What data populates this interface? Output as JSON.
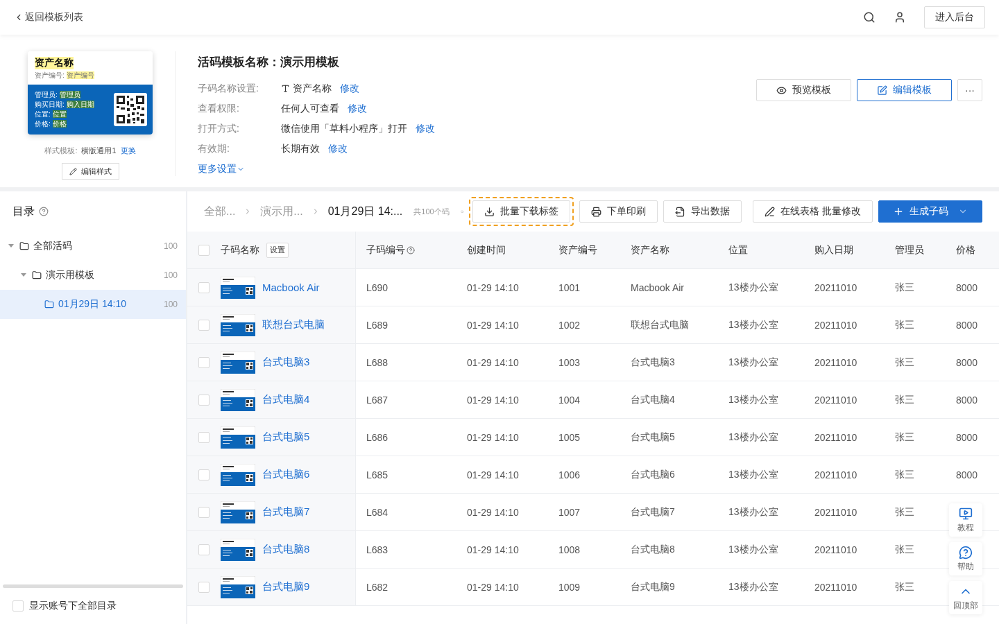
{
  "topbar": {
    "back": "返回模板列表",
    "action": "进入后台"
  },
  "template": {
    "card": {
      "title": "资产名称",
      "subtitle_label": "资产编号:",
      "subtitle_value": "资产编号",
      "fields": [
        {
          "label": "管理员:",
          "value": "管理员"
        },
        {
          "label": "购买日期:",
          "value": "购入日期"
        },
        {
          "label": "位置:",
          "value": "位置"
        },
        {
          "label": "价格:",
          "value": "价格"
        }
      ]
    },
    "style_label": "样式模板:",
    "style_value": "横版通用1",
    "style_link": "更换",
    "edit_style": "编辑样式",
    "title": "活码模板名称：演示用模板",
    "settings": [
      {
        "kind": "field",
        "label": "子码名称设置:",
        "value": "资产名称",
        "link": "修改"
      },
      {
        "kind": "text",
        "label": "查看权限:",
        "value": "任何人可查看",
        "link": "修改"
      },
      {
        "kind": "text",
        "label": "打开方式:",
        "value": "微信使用「草料小程序」打开",
        "link": "修改"
      },
      {
        "kind": "text",
        "label": "有效期:",
        "value": "长期有效",
        "link": "修改"
      }
    ],
    "more": "更多设置",
    "buttons": [
      {
        "kind": "preview",
        "label": "预览模板"
      },
      {
        "kind": "edit",
        "label": "编辑模板"
      },
      {
        "kind": "more",
        "label": "···"
      }
    ]
  },
  "sidebar": {
    "title": "目录",
    "tree": [
      {
        "label": "全部活码",
        "count": "100",
        "expanded": true,
        "selected": false,
        "children": [
          {
            "label": "演示用模板",
            "count": "100",
            "expanded": true,
            "selected": false,
            "children": [
              {
                "label": "01月29日 14:10",
                "count": "100",
                "selected": true
              }
            ]
          }
        ]
      }
    ],
    "show_all": {
      "label": "显示账号下全部目录",
      "checked": false
    }
  },
  "toolbar": {
    "breadcrumb": [
      "全部...",
      "演示用...",
      "01月29日 14:..."
    ],
    "total": "共100个码",
    "buttons": [
      {
        "kind": "download",
        "label": "批量下载标签",
        "highlighted": true
      },
      {
        "kind": "print",
        "label": "下单印刷",
        "highlighted": false
      },
      {
        "kind": "export",
        "label": "导出数据",
        "highlighted": false
      },
      {
        "kind": "edit",
        "label": "在线表格 批量修改",
        "highlighted": false
      },
      {
        "kind": "primary",
        "label": "生成子码",
        "highlighted": false
      }
    ]
  },
  "table": {
    "all_checked": false,
    "setting": "设置",
    "columns": [
      "子码名称",
      "子码编号",
      "创建时间",
      "资产编号",
      "资产名称",
      "位置",
      "购入日期",
      "管理员",
      "价格"
    ],
    "rows": [
      {
        "checked": false,
        "cells": [
          "Macbook Air",
          "L690",
          "01-29 14:10",
          "1001",
          "Macbook Air",
          "13楼办公室",
          "20211010",
          "张三",
          "8000"
        ]
      },
      {
        "checked": false,
        "cells": [
          "联想台式电脑",
          "L689",
          "01-29 14:10",
          "1002",
          "联想台式电脑",
          "13楼办公室",
          "20211010",
          "张三",
          "8000"
        ]
      },
      {
        "checked": false,
        "cells": [
          "台式电脑3",
          "L688",
          "01-29 14:10",
          "1003",
          "台式电脑3",
          "13楼办公室",
          "20211010",
          "张三",
          "8000"
        ]
      },
      {
        "checked": false,
        "cells": [
          "台式电脑4",
          "L687",
          "01-29 14:10",
          "1004",
          "台式电脑4",
          "13楼办公室",
          "20211010",
          "张三",
          "8000"
        ]
      },
      {
        "checked": false,
        "cells": [
          "台式电脑5",
          "L686",
          "01-29 14:10",
          "1005",
          "台式电脑5",
          "13楼办公室",
          "20211010",
          "张三",
          "8000"
        ]
      },
      {
        "checked": false,
        "cells": [
          "台式电脑6",
          "L685",
          "01-29 14:10",
          "1006",
          "台式电脑6",
          "13楼办公室",
          "20211010",
          "张三",
          "8000"
        ]
      },
      {
        "checked": false,
        "cells": [
          "台式电脑7",
          "L684",
          "01-29 14:10",
          "1007",
          "台式电脑7",
          "13楼办公室",
          "20211010",
          "张三"
        ]
      },
      {
        "checked": false,
        "cells": [
          "台式电脑8",
          "L683",
          "01-29 14:10",
          "1008",
          "台式电脑8",
          "13楼办公室",
          "20211010",
          "张三"
        ]
      },
      {
        "checked": false,
        "cells": [
          "台式电脑9",
          "L682",
          "01-29 14:10",
          "1009",
          "台式电脑9",
          "13楼办公室",
          "20211010",
          "张三"
        ]
      }
    ]
  },
  "float": [
    {
      "kind": "video",
      "label": "教程"
    },
    {
      "kind": "help",
      "label": "帮助"
    },
    {
      "kind": "top",
      "label": "回顶部"
    }
  ]
}
